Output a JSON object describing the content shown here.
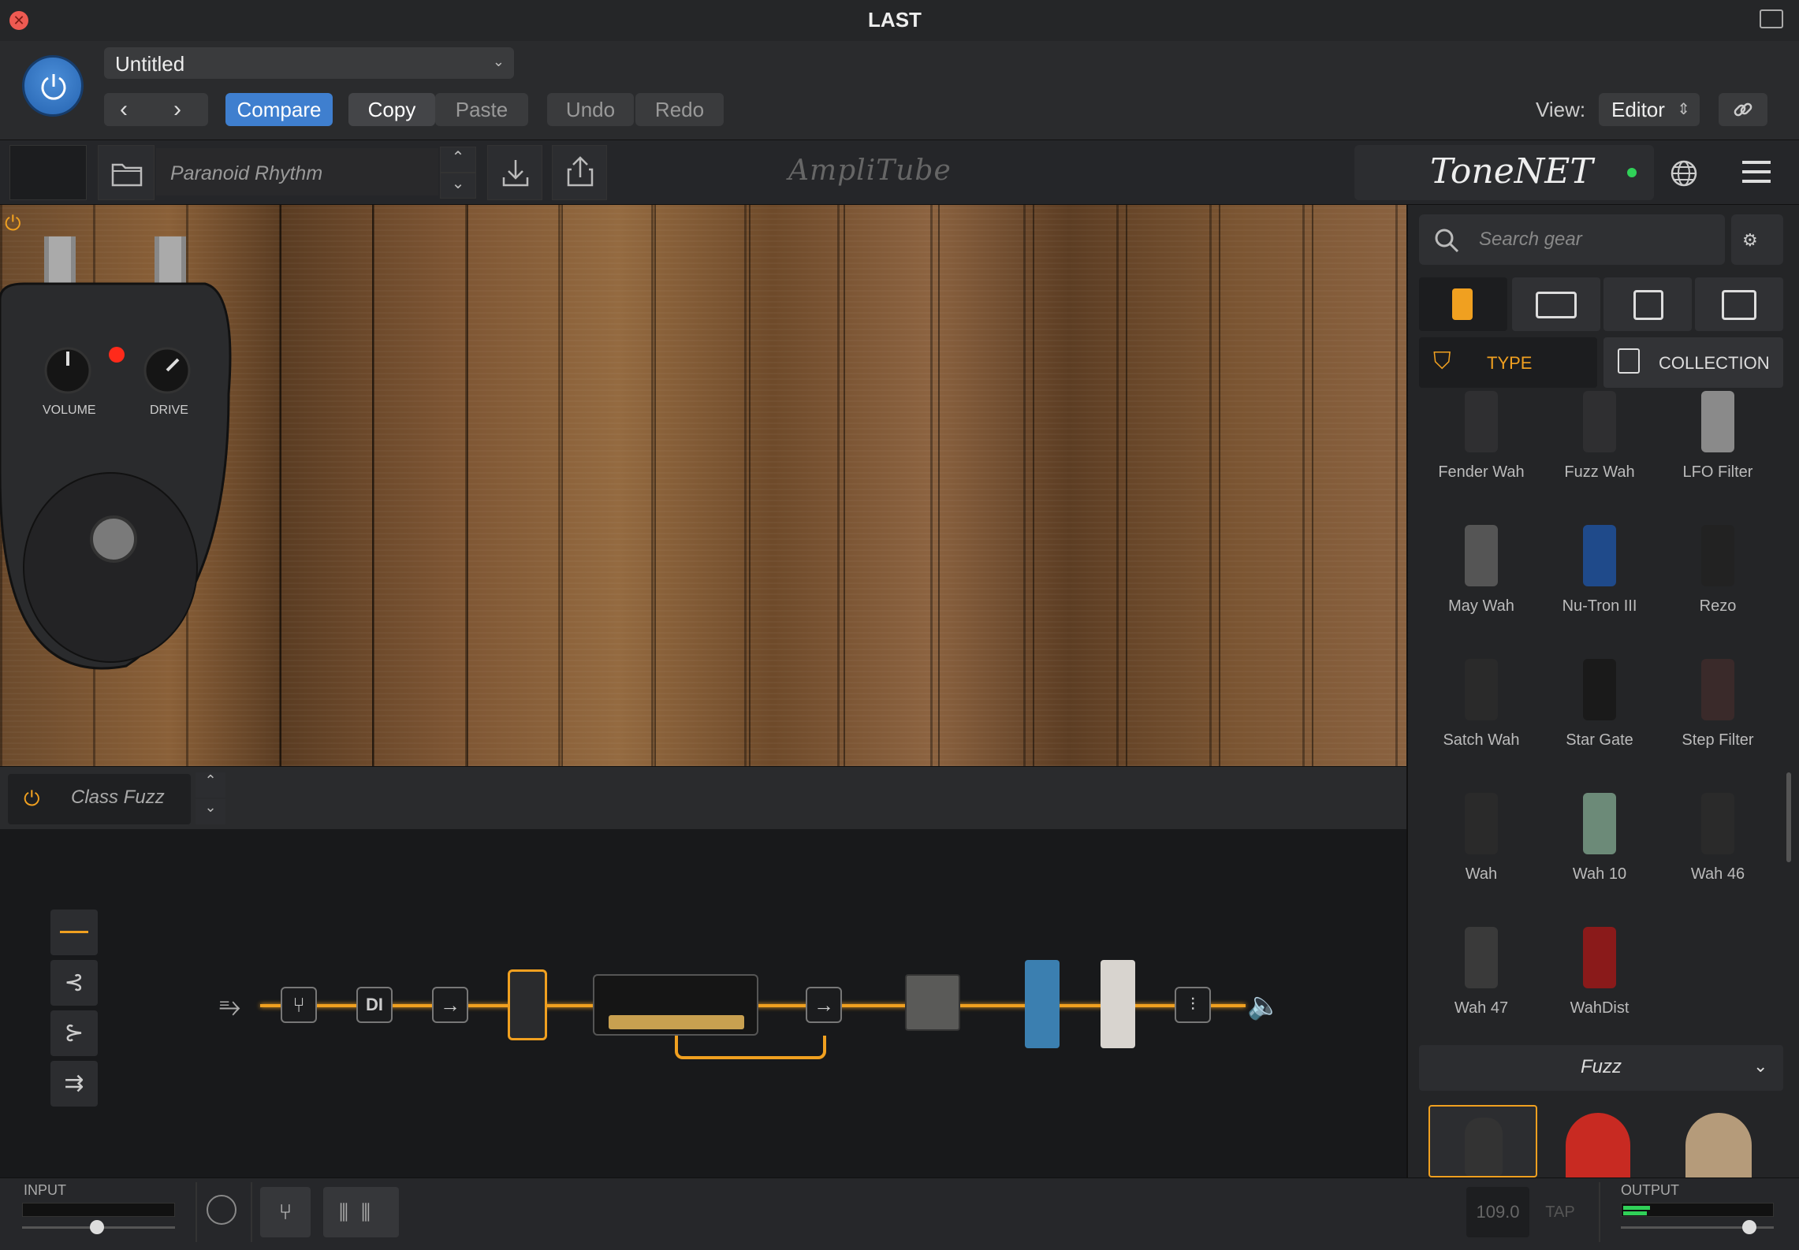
{
  "window": {
    "title": "LAST"
  },
  "host": {
    "preset_name": "Untitled",
    "compare_label": "Compare",
    "copy_label": "Copy",
    "paste_label": "Paste",
    "undo_label": "Undo",
    "redo_label": "Redo",
    "view_label": "View:",
    "view_value": "Editor"
  },
  "toolbar": {
    "preset_name": "Paranoid Rhythm",
    "logo_text": "AmpliTube",
    "tonenet_text": "ToneNET"
  },
  "pedal": {
    "volume_label": "VOLUME",
    "drive_label": "DRIVE"
  },
  "selected_block": {
    "name": "Class Fuzz"
  },
  "chain": {
    "di_label": "DI"
  },
  "browser": {
    "search_placeholder": "Search gear",
    "type_label": "TYPE",
    "collection_label": "COLLECTION",
    "gear": [
      {
        "name": "Fender Wah"
      },
      {
        "name": "Fuzz Wah"
      },
      {
        "name": "LFO Filter"
      },
      {
        "name": "May Wah"
      },
      {
        "name": "Nu-Tron III"
      },
      {
        "name": "Rezo"
      },
      {
        "name": "Satch Wah"
      },
      {
        "name": "Star Gate"
      },
      {
        "name": "Step Filter"
      },
      {
        "name": "Wah"
      },
      {
        "name": "Wah 10"
      },
      {
        "name": "Wah 46"
      },
      {
        "name": "Wah 47"
      },
      {
        "name": "WahDist"
      }
    ],
    "fuzz_category": "Fuzz"
  },
  "footer": {
    "input_label": "INPUT",
    "output_label": "OUTPUT",
    "bpm": "109.0",
    "tap_label": "TAP"
  }
}
